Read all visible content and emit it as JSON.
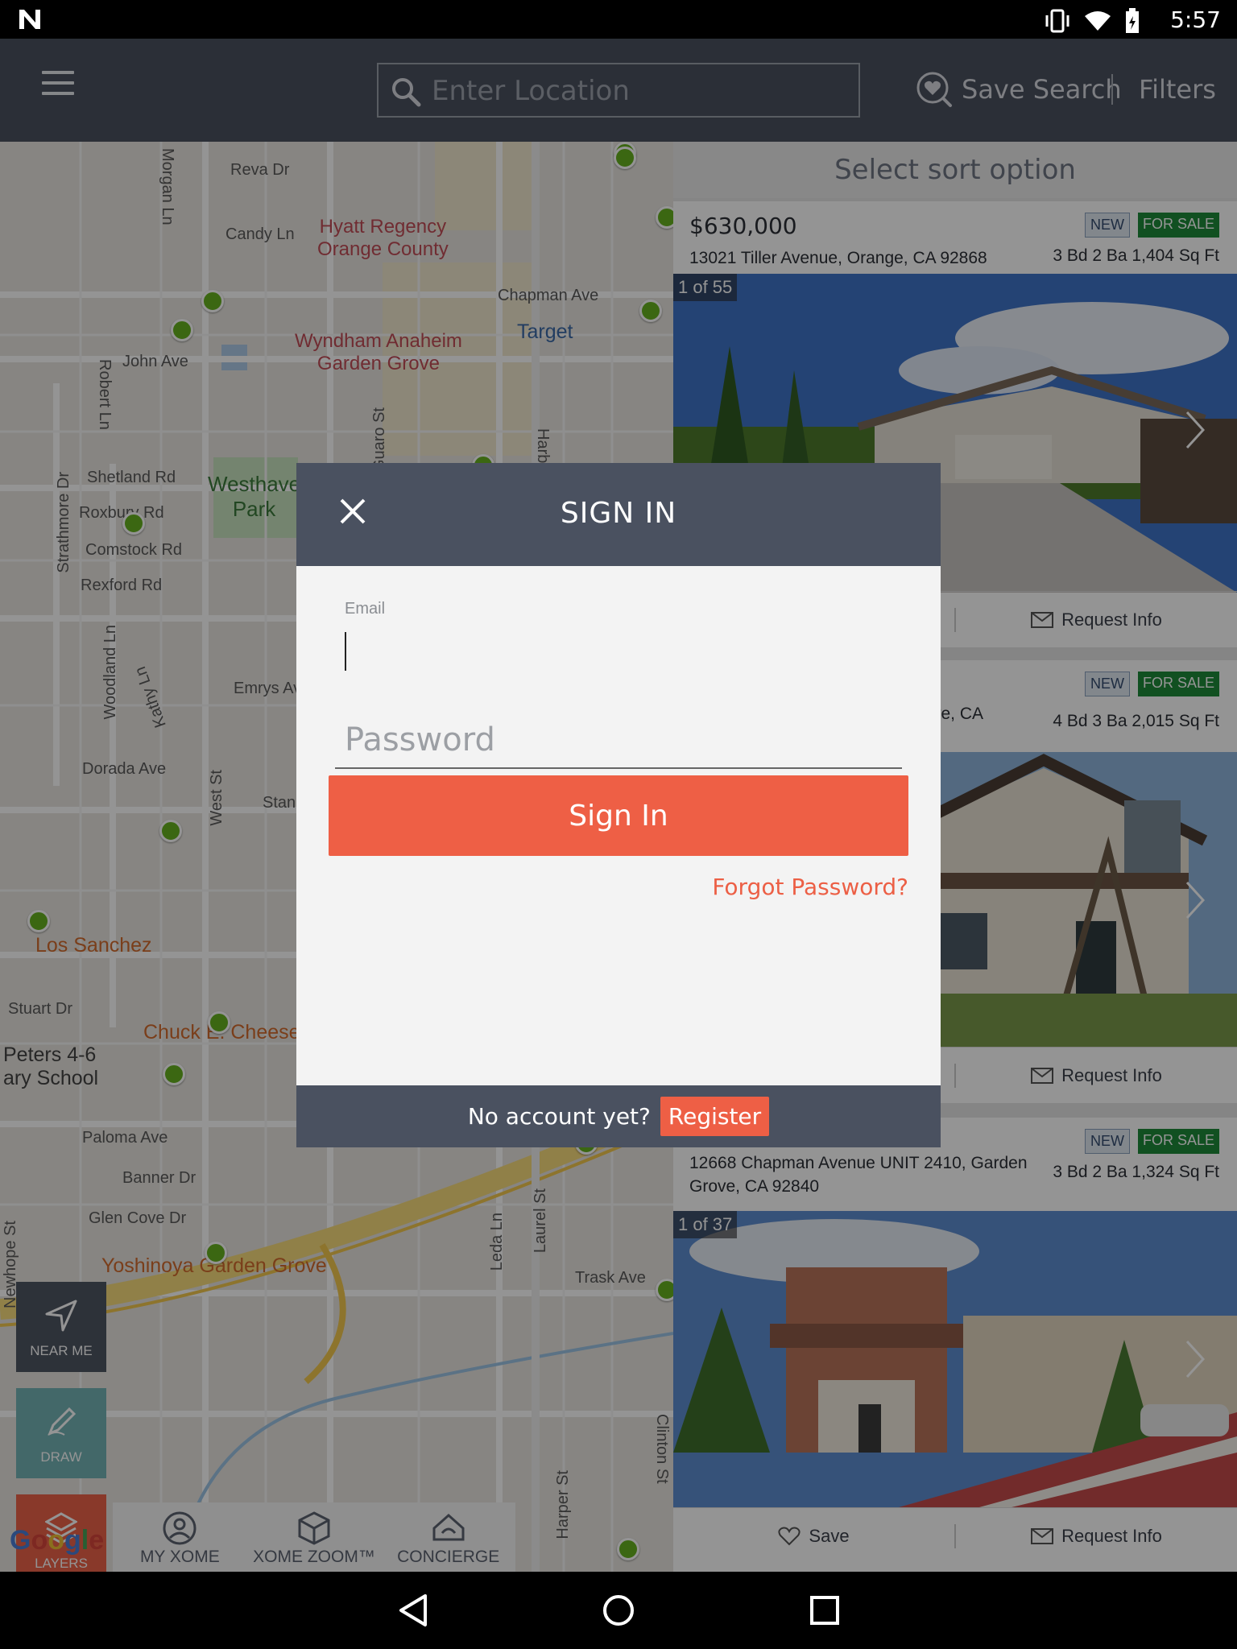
{
  "status_bar": {
    "time": "5:57"
  },
  "header": {
    "search": {
      "placeholder": "Enter Location"
    },
    "save_search_label": "Save Search",
    "filters_label": "Filters"
  },
  "map": {
    "streets": [
      "Reva Dr",
      "Candy Ln",
      "Morgan Ln",
      "Chapman Ave",
      "John Ave",
      "Robert Ln",
      "Shetland Rd",
      "Roxbury Rd",
      "Comstock Rd",
      "Rexford Rd",
      "Strathmore Dr",
      "Emrys Ave",
      "Woodland Ln",
      "Kathy Ln",
      "Dorada Ave",
      "West St",
      "Stuart Dr",
      "Paloma Ave",
      "Banner Dr",
      "Glen Cove Dr",
      "Trask Ave",
      "Leda Ln",
      "Laurel St",
      "Harper St",
      "Clinton St",
      "Newhope St",
      "Guaro St",
      "Harb",
      "Stan",
      "Emrys Av",
      "C"
    ],
    "pois": {
      "hyatt": "Hyatt Regency\nOrange County",
      "wyndham": "Wyndham Anaheim\nGarden Grove",
      "target": "Target",
      "park": "Westhave\nPark",
      "los_sanchez": "Los Sanchez",
      "chuck": "Chuck E. Cheese",
      "peters": "Peters 4-6\nary School",
      "yoshinoya": "Yoshinoya Garden Grove"
    },
    "buttons": {
      "near_me": "NEAR ME",
      "draw": "DRAW",
      "layers": "LAYERS"
    },
    "google": "Google"
  },
  "bottom_tabs": [
    {
      "label": "MY XOME",
      "icon": "person-icon"
    },
    {
      "label": "XOME ZOOM™",
      "icon": "cube-icon"
    },
    {
      "label": "CONCIERGE",
      "icon": "concierge-icon"
    }
  ],
  "listings": {
    "sort_label": "Select sort option",
    "cards": [
      {
        "price": "$630,000",
        "address": "13021 Tiller Avenue, Orange, CA 92868",
        "specs": "3 Bd  2 Ba  1,404 Sq Ft",
        "badge_new": "NEW",
        "badge_sale": "FOR SALE",
        "counter": "1 of 55",
        "request_info": "Request Info"
      },
      {
        "price": "",
        "address": "ve, CA",
        "specs": "4 Bd  3 Ba  2,015 Sq Ft",
        "badge_new": "NEW",
        "badge_sale": "FOR SALE",
        "counter": "",
        "request_info": "Request Info"
      },
      {
        "price": "",
        "address": "12668 Chapman Avenue UNIT 2410, Garden Grove, CA 92840",
        "specs": "3 Bd  2 Ba  1,324 Sq Ft",
        "badge_new": "NEW",
        "badge_sale": "FOR SALE",
        "counter": "1 of 37",
        "save": "Save",
        "request_info": "Request Info"
      }
    ]
  },
  "modal": {
    "title": "SIGN IN",
    "email_label": "Email",
    "email_value": "",
    "password_placeholder": "Password",
    "signin_label": "Sign In",
    "forgot_label": "Forgot Password?",
    "no_account": "No account yet?",
    "register_label": "Register"
  },
  "colors": {
    "header_bg": "#4a5160",
    "accent": "#ee5f45",
    "pin": "#67b11f",
    "sale_badge": "#1e8b3a"
  }
}
